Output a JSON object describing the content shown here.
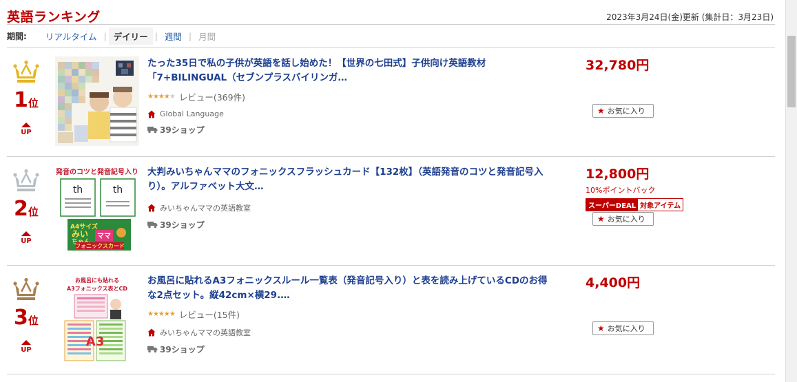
{
  "header": {
    "title": "英語ランキング",
    "updated": "2023年3月24日(金)更新 (集計日：3月23日)"
  },
  "period": {
    "label": "期間:",
    "tabs": [
      "リアルタイム",
      "デイリー",
      "週間",
      "月間"
    ],
    "active_index": 1
  },
  "colors": {
    "accent": "#bf0000",
    "link": "#1d3f8f",
    "star": "#e5a03a"
  },
  "items": [
    {
      "rank": "1",
      "rank_unit": "位",
      "rank_change": "UP",
      "crown": "gold-crown-icon",
      "title": "たった35日で私の子供が英語を話し始めた！【世界の七田式】子供向け英語教材「7+BILINGUAL（セブンプラスバイリンガ…",
      "rating": 4.5,
      "review_text": "レビュー(369件)",
      "shop": "Global Language",
      "shipping": "39ショップ",
      "price": "32,780円",
      "favorite": "お気に入り"
    },
    {
      "rank": "2",
      "rank_unit": "位",
      "rank_change": "UP",
      "crown": "silver-crown-icon",
      "title": "大判みいちゃんママのフォニックスフラッシュカード【132枚】（英語発音のコツと発音記号入り）。アルファベット大文…",
      "shop": "みいちゃんママの英語教室",
      "shipping": "39ショップ",
      "price": "12,800円",
      "point_back": "10%ポイントバック",
      "deal_main": "スーパーDEAL",
      "deal_sub": "対象アイテム",
      "favorite": "お気に入り",
      "thumb_texts": [
        "発音のコツと発音記号入り",
        "th",
        "th",
        "A4サイズ",
        "みい",
        "ちゃん",
        "ママ",
        "フォニックスカード"
      ]
    },
    {
      "rank": "3",
      "rank_unit": "位",
      "rank_change": "UP",
      "crown": "bronze-crown-icon",
      "title": "お風呂に貼れるA3フォニックスルール一覧表（発音記号入り）と表を読み上げているCDのお得な2点セット。縦42cm×横29.…",
      "rating": 5,
      "review_text": "レビュー(15件)",
      "shop": "みいちゃんママの英語教室",
      "shipping": "39ショップ",
      "price": "4,400円",
      "favorite": "お気に入り",
      "thumb_texts": [
        "お風呂にも貼れる",
        "A3フォニックス表とCD",
        "A3"
      ]
    }
  ]
}
